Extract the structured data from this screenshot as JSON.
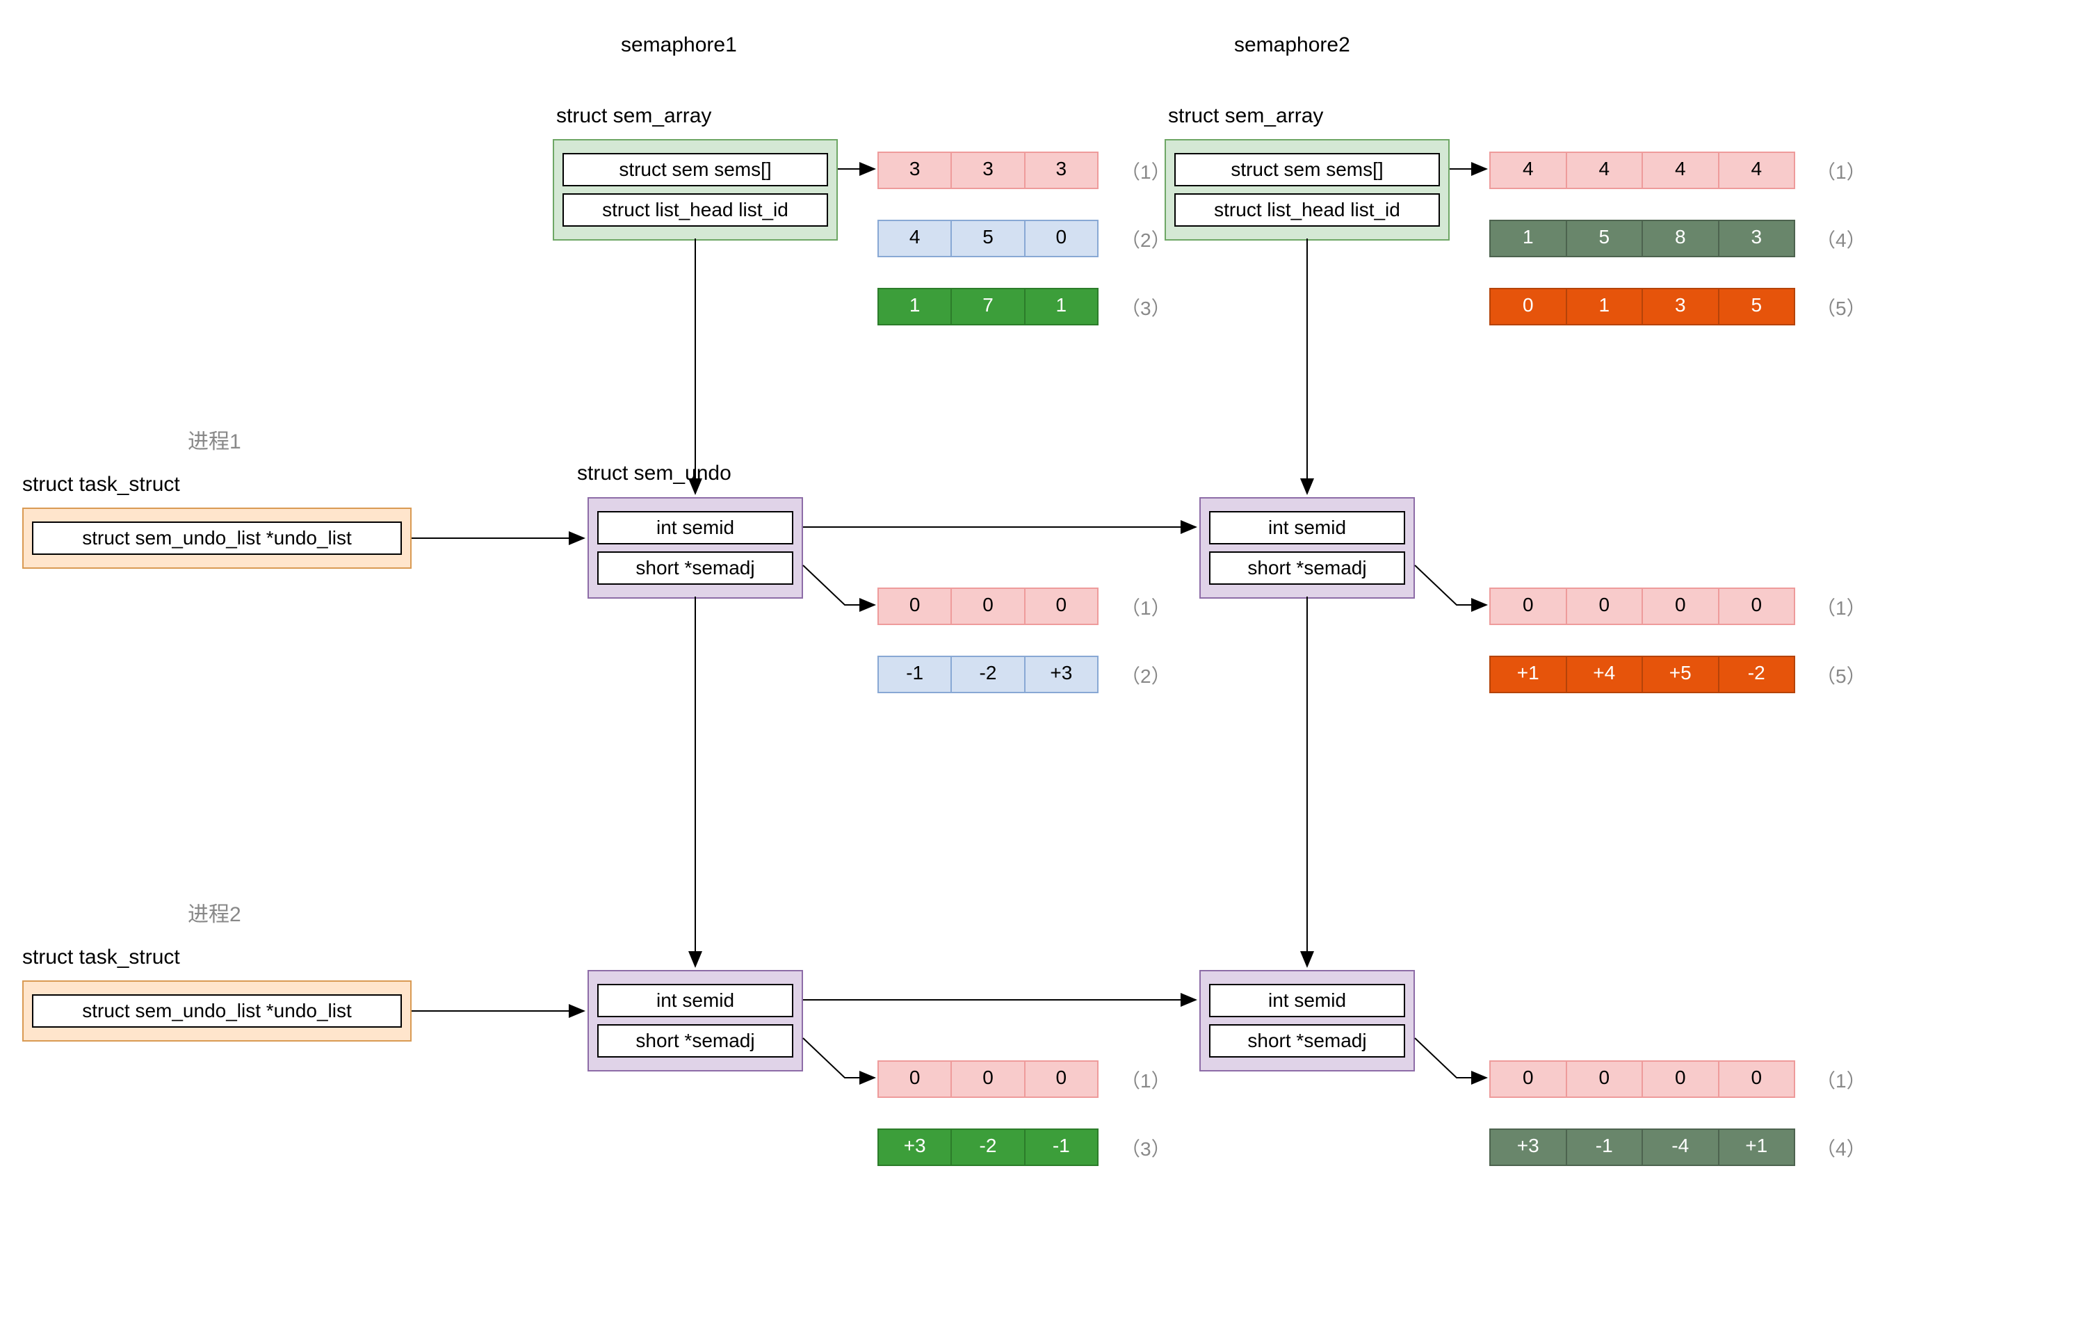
{
  "labels": {
    "semaphore1": "semaphore1",
    "semaphore2": "semaphore2",
    "process1": "进程1",
    "process2": "进程2",
    "struct_sem_array": "struct sem_array",
    "struct_task_struct": "struct task_struct",
    "struct_sem_undo": "struct sem_undo",
    "sem_sems": "struct sem sems[]",
    "list_head": "struct list_head list_id",
    "undo_list": "struct sem_undo_list *undo_list",
    "int_semid": "int semid",
    "short_semadj": "short *semadj"
  },
  "sem_array1": {
    "rows": [
      {
        "color": "pink",
        "vals": [
          "3",
          "3",
          "3"
        ],
        "tag": "（1）"
      },
      {
        "color": "blue",
        "vals": [
          "4",
          "5",
          "0"
        ],
        "tag": "（2）"
      },
      {
        "color": "green",
        "vals": [
          "1",
          "7",
          "1"
        ],
        "tag": "（3）"
      }
    ]
  },
  "sem_array2": {
    "rows": [
      {
        "color": "pink",
        "vals": [
          "4",
          "4",
          "4",
          "4"
        ],
        "tag": "（1）"
      },
      {
        "color": "darkgreen",
        "vals": [
          "1",
          "5",
          "8",
          "3"
        ],
        "tag": "（4）"
      },
      {
        "color": "orange",
        "vals": [
          "0",
          "1",
          "3",
          "5"
        ],
        "tag": "（5）"
      }
    ]
  },
  "undo_p1_s1": {
    "rows": [
      {
        "color": "pink",
        "vals": [
          "0",
          "0",
          "0"
        ],
        "tag": "（1）"
      },
      {
        "color": "blue",
        "vals": [
          "-1",
          "-2",
          "+3"
        ],
        "tag": "（2）"
      }
    ]
  },
  "undo_p1_s2": {
    "rows": [
      {
        "color": "pink",
        "vals": [
          "0",
          "0",
          "0",
          "0"
        ],
        "tag": "（1）"
      },
      {
        "color": "orange",
        "vals": [
          "+1",
          "+4",
          "+5",
          "-2"
        ],
        "tag": "（5）"
      }
    ]
  },
  "undo_p2_s1": {
    "rows": [
      {
        "color": "pink",
        "vals": [
          "0",
          "0",
          "0"
        ],
        "tag": "（1）"
      },
      {
        "color": "green",
        "vals": [
          "+3",
          "-2",
          "-1"
        ],
        "tag": "（3）"
      }
    ]
  },
  "undo_p2_s2": {
    "rows": [
      {
        "color": "pink",
        "vals": [
          "0",
          "0",
          "0",
          "0"
        ],
        "tag": "（1）"
      },
      {
        "color": "darkgreen",
        "vals": [
          "+3",
          "-1",
          "-4",
          "+1"
        ],
        "tag": "（4）"
      }
    ]
  }
}
